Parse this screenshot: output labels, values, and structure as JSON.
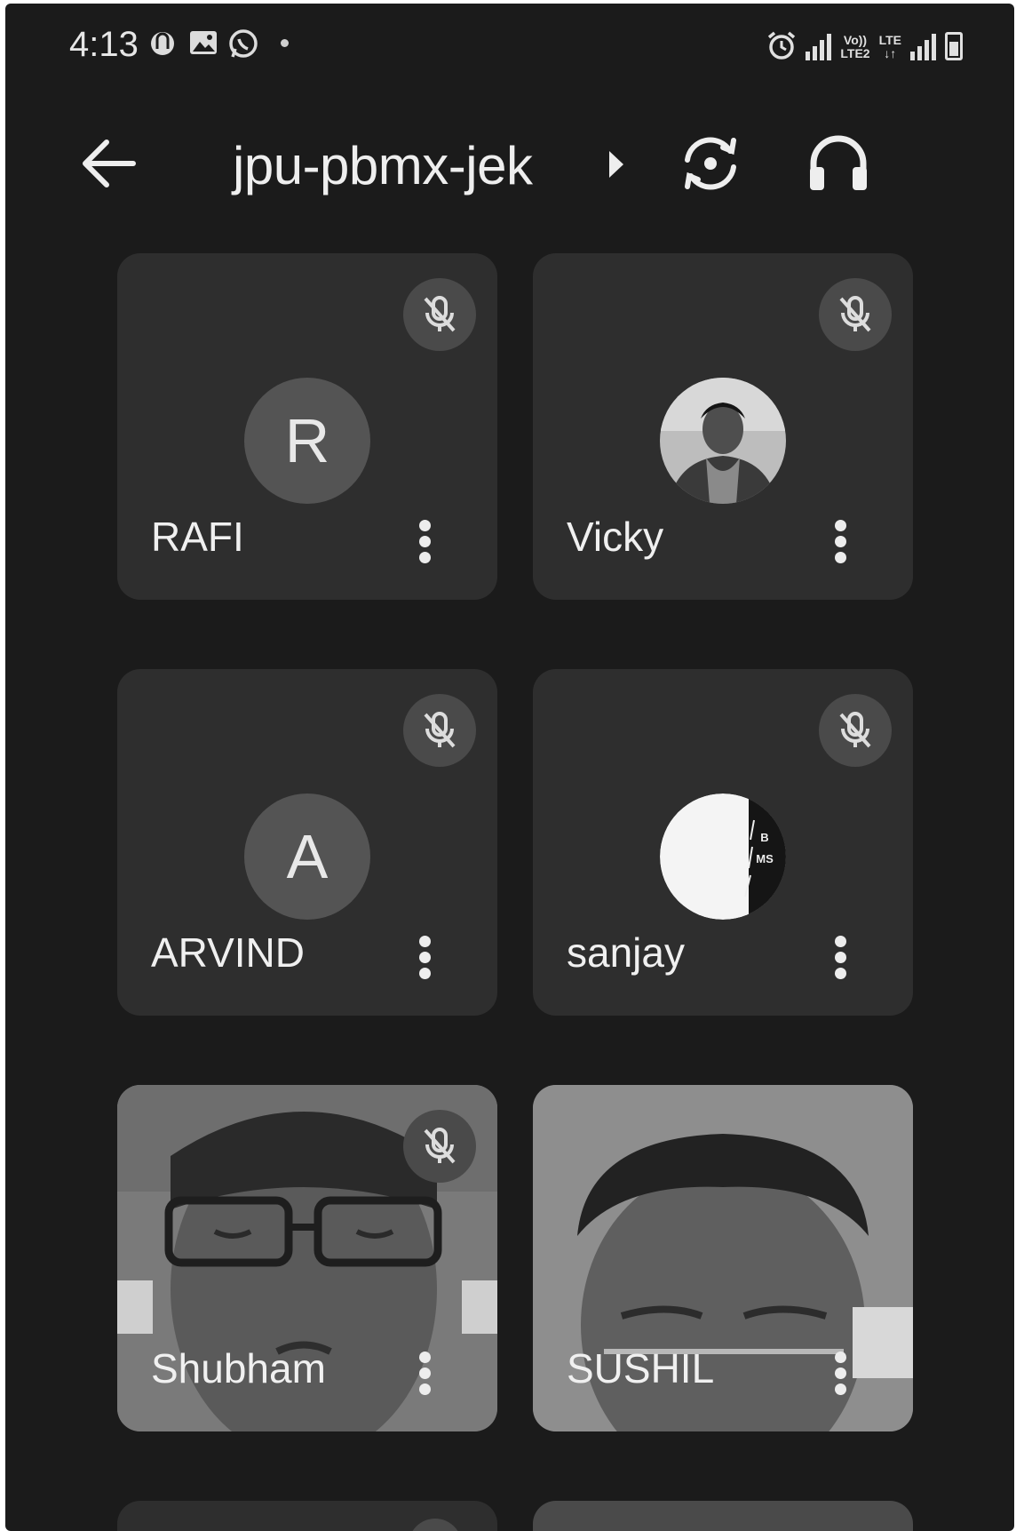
{
  "status_bar": {
    "time": "4:13",
    "network_label_top": "Vo))",
    "network_label_bottom": "LTE2",
    "lte_label": "LTE"
  },
  "header": {
    "meeting_code": "jpu-pbmx-jek"
  },
  "participants": [
    {
      "name": "RAFI",
      "initial": "R",
      "muted": true,
      "avatar": "initial"
    },
    {
      "name": "Vicky",
      "initial": "",
      "muted": true,
      "avatar": "photo"
    },
    {
      "name": "ARVIND",
      "initial": "A",
      "muted": true,
      "avatar": "initial"
    },
    {
      "name": "sanjay",
      "initial": "",
      "muted": true,
      "avatar": "logo"
    },
    {
      "name": "Shubham",
      "initial": "",
      "muted": true,
      "avatar": "video"
    },
    {
      "name": "SUSHIL",
      "initial": "",
      "muted": false,
      "avatar": "video"
    }
  ],
  "logo_text": "BMS",
  "colors": {
    "background": "#1b1b1b",
    "tile": "#2e2e2e",
    "avatar_circle": "#545454",
    "text": "#f0f0f0"
  }
}
